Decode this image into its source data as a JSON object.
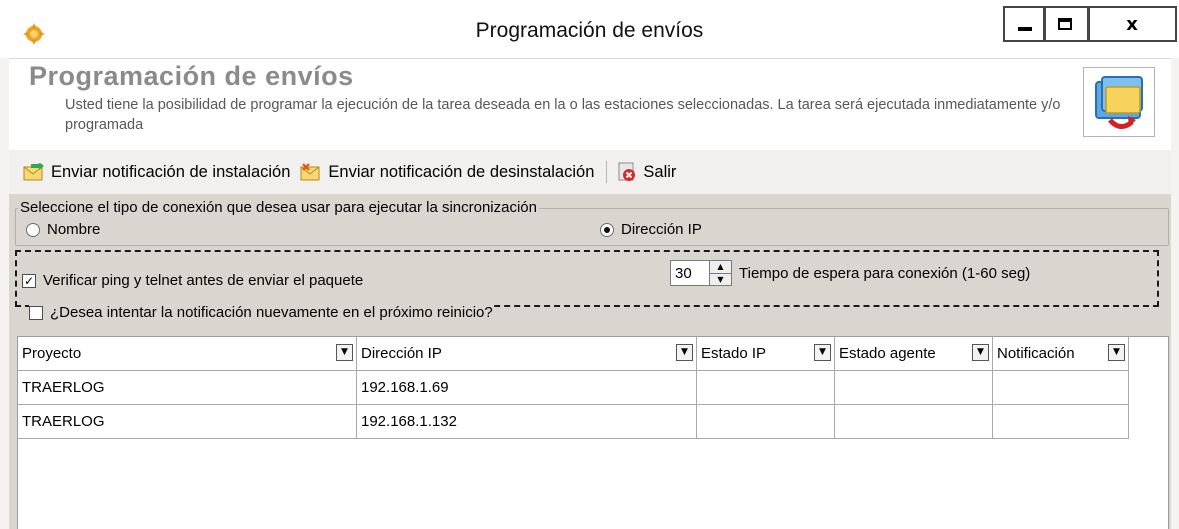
{
  "window": {
    "title": "Programación de envíos",
    "controls": {
      "minimize": "minimize",
      "maximize": "maximize",
      "close": "x"
    }
  },
  "header": {
    "title": "Programación de envíos",
    "description": "Usted tiene la posibilidad de programar la ejecución de la tarea deseada en la o las estaciones seleccionadas. La tarea será ejecutada inmediatamente y/o programada"
  },
  "toolbar": {
    "send_install_label": "Enviar notificación de instalación",
    "send_uninstall_label": "Enviar notificación de desinstalación",
    "exit_label": "Salir"
  },
  "connection": {
    "legend": "Seleccione el tipo de conexión que desea usar para ejecutar la sincronización",
    "options": [
      {
        "label": "Nombre",
        "selected": false
      },
      {
        "label": "Dirección IP",
        "selected": true
      }
    ]
  },
  "options": {
    "verify_label": "Verificar ping y telnet antes de enviar el paquete",
    "verify_checked": true,
    "timeout_value": "30",
    "timeout_label": "Tiempo de espera para conexión (1-60 seg)",
    "retry_label": "¿Desea intentar la notificación nuevamente en el próximo reinicio?",
    "retry_checked": false
  },
  "grid": {
    "columns": [
      "Proyecto",
      "Dirección IP",
      "Estado IP",
      "Estado agente",
      "Notificación"
    ],
    "rows": [
      [
        "TRAERLOG",
        "192.168.1.69",
        "",
        "",
        ""
      ],
      [
        "TRAERLOG",
        "192.168.1.132",
        "",
        "",
        ""
      ]
    ]
  }
}
